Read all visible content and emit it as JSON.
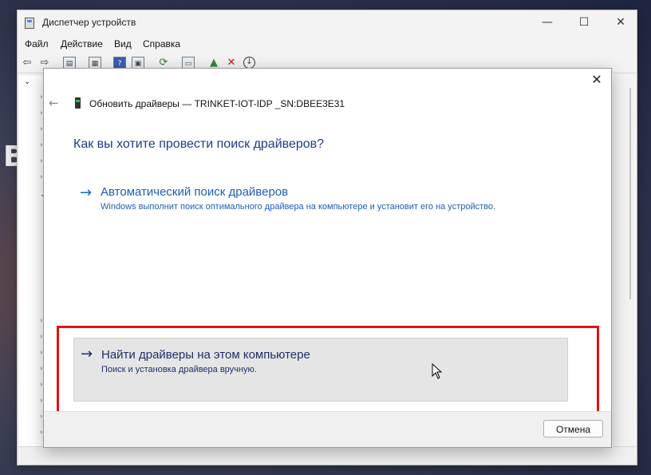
{
  "background": {
    "partial_letter": "B"
  },
  "window": {
    "title": "Диспетчер устройств",
    "controls": {
      "minimize": "—",
      "maximize": "☐",
      "close": "✕"
    }
  },
  "menu": [
    "Файл",
    "Действие",
    "Вид",
    "Справка"
  ],
  "toolbar_icons": [
    "back-arrow-icon",
    "forward-arrow-icon",
    "properties-icon",
    "view-icon",
    "help-icon",
    "device-icon",
    "update-driver-icon",
    "monitor-icon",
    "enable-device-icon",
    "uninstall-icon",
    "scan-hardware-icon"
  ],
  "dialog": {
    "close": "✕",
    "back": "←",
    "header": "Обновить драйверы — TRINKET-IOT-IDP _SN:DBEE3E31",
    "question": "Как вы хотите провести поиск драйверов?",
    "options": [
      {
        "arrow": "→",
        "title": "Автоматический поиск драйверов",
        "description": "Windows выполнит поиск оптимального драйвера на компьютере и установит его на устройство."
      },
      {
        "arrow": "→",
        "title": "Найти драйверы на этом компьютере",
        "description": "Поиск и установка драйвера вручную."
      }
    ],
    "cancel": "Отмена"
  },
  "colors": {
    "link": "#1f5db8",
    "heading": "#1f3b8b",
    "highlight": "#e01414"
  }
}
